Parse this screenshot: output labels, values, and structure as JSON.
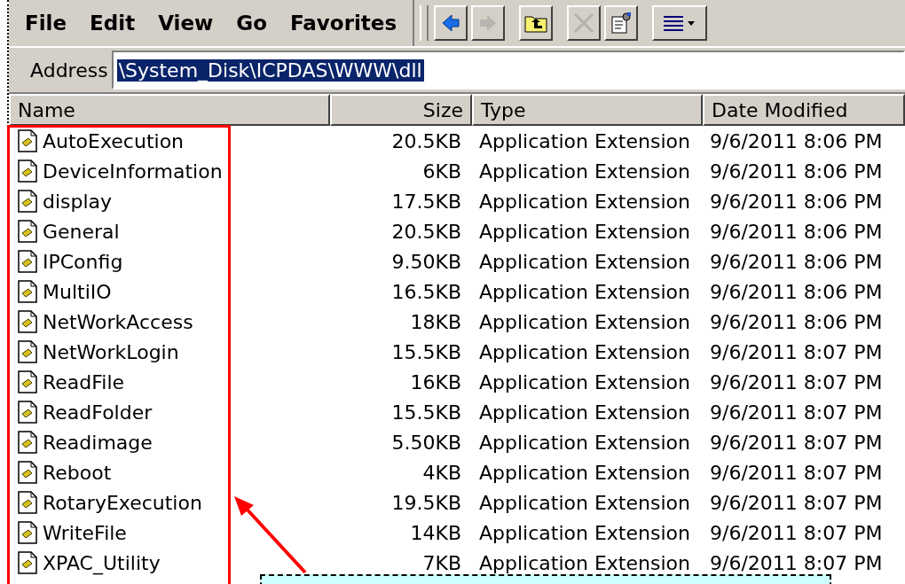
{
  "menu": [
    {
      "label": "File"
    },
    {
      "label": "Edit"
    },
    {
      "label": "View"
    },
    {
      "label": "Go"
    },
    {
      "label": "Favorites"
    }
  ],
  "toolbar": [
    {
      "kind": "back",
      "disabled": false
    },
    {
      "kind": "forward",
      "disabled": true
    },
    {
      "kind": "up",
      "disabled": false
    },
    {
      "kind": "delete",
      "disabled": true
    },
    {
      "kind": "properties",
      "disabled": false
    },
    {
      "kind": "views",
      "disabled": false
    }
  ],
  "address": {
    "label": "Address",
    "value": "\\System_Disk\\ICPDAS\\WWW\\dll",
    "selected": true
  },
  "table": {
    "columns": [
      "Name",
      "Size",
      "Type",
      "Date Modified"
    ],
    "rows": [
      {
        "name": "AutoExecution",
        "size": "20.5KB",
        "type": "Application Extension",
        "date": "9/6/2011 8:06 PM"
      },
      {
        "name": "DeviceInformation",
        "size": "6KB",
        "type": "Application Extension",
        "date": "9/6/2011 8:06 PM"
      },
      {
        "name": "display",
        "size": "17.5KB",
        "type": "Application Extension",
        "date": "9/6/2011 8:06 PM"
      },
      {
        "name": "General",
        "size": "20.5KB",
        "type": "Application Extension",
        "date": "9/6/2011 8:06 PM"
      },
      {
        "name": "IPConfig",
        "size": "9.50KB",
        "type": "Application Extension",
        "date": "9/6/2011 8:06 PM"
      },
      {
        "name": "MultiIO",
        "size": "16.5KB",
        "type": "Application Extension",
        "date": "9/6/2011 8:06 PM"
      },
      {
        "name": "NetWorkAccess",
        "size": "18KB",
        "type": "Application Extension",
        "date": "9/6/2011 8:06 PM"
      },
      {
        "name": "NetWorkLogin",
        "size": "15.5KB",
        "type": "Application Extension",
        "date": "9/6/2011 8:07 PM"
      },
      {
        "name": "ReadFile",
        "size": "16KB",
        "type": "Application Extension",
        "date": "9/6/2011 8:07 PM"
      },
      {
        "name": "ReadFolder",
        "size": "15.5KB",
        "type": "Application Extension",
        "date": "9/6/2011 8:07 PM"
      },
      {
        "name": "Readimage",
        "size": "5.50KB",
        "type": "Application Extension",
        "date": "9/6/2011 8:07 PM"
      },
      {
        "name": "Reboot",
        "size": "4KB",
        "type": "Application Extension",
        "date": "9/6/2011 8:07 PM"
      },
      {
        "name": "RotaryExecution",
        "size": "19.5KB",
        "type": "Application Extension",
        "date": "9/6/2011 8:07 PM"
      },
      {
        "name": "WriteFile",
        "size": "14KB",
        "type": "Application Extension",
        "date": "9/6/2011 8:07 PM"
      },
      {
        "name": "XPAC_Utility",
        "size": "7KB",
        "type": "Application Extension",
        "date": "9/6/2011 8:07 PM"
      }
    ]
  }
}
